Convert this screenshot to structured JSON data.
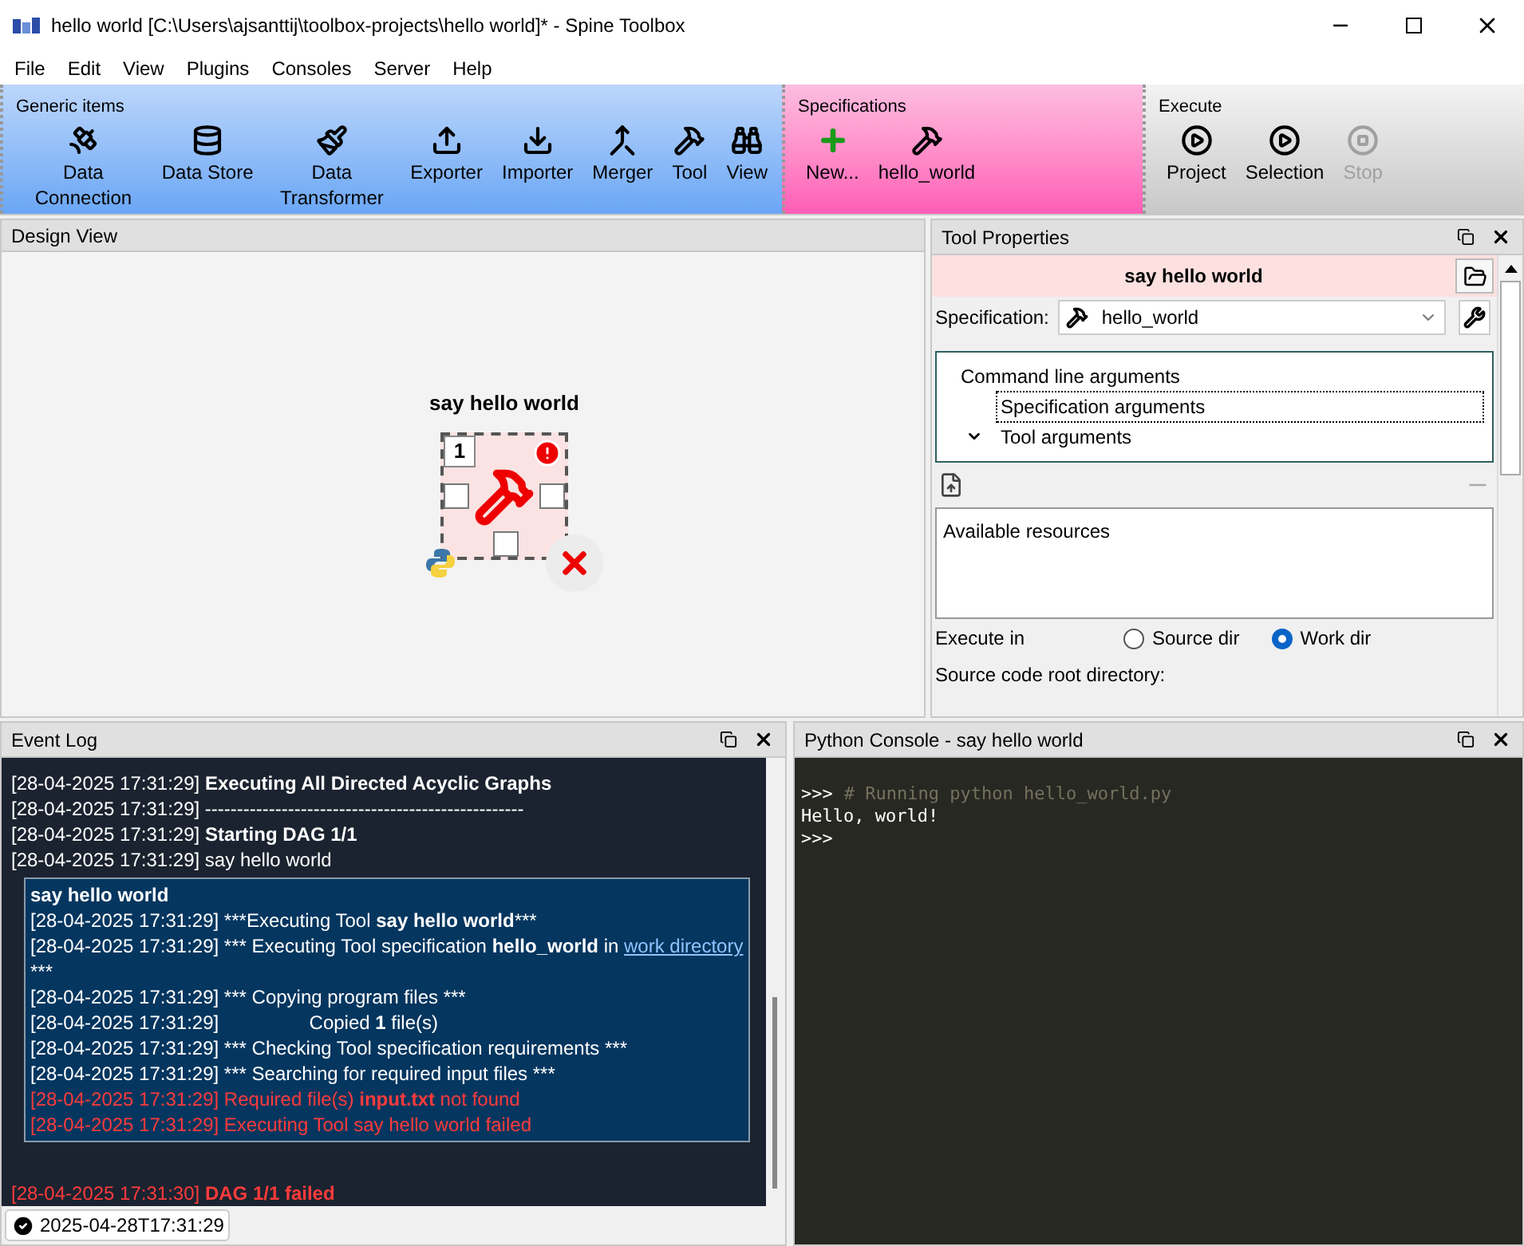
{
  "window": {
    "title": "hello world [C:\\Users\\ajsanttij\\toolbox-projects\\hello world]* - Spine Toolbox"
  },
  "menu": [
    "File",
    "Edit",
    "View",
    "Plugins",
    "Consoles",
    "Server",
    "Help"
  ],
  "toolbar": {
    "groups": [
      {
        "kind": "generic",
        "title": "Generic items",
        "items": [
          {
            "label": "Data Connection",
            "disabled": false
          },
          {
            "label": "Data Store",
            "disabled": false
          },
          {
            "label": "Data Transformer",
            "disabled": false
          },
          {
            "label": "Exporter",
            "disabled": false
          },
          {
            "label": "Importer",
            "disabled": false
          },
          {
            "label": "Merger",
            "disabled": false
          },
          {
            "label": "Tool",
            "disabled": false
          },
          {
            "label": "View",
            "disabled": false
          }
        ]
      },
      {
        "kind": "specs",
        "title": "Specifications",
        "items": [
          {
            "label": "New...",
            "disabled": false
          },
          {
            "label": "hello_world",
            "disabled": false
          }
        ]
      },
      {
        "kind": "execute",
        "title": "Execute",
        "items": [
          {
            "label": "Project",
            "disabled": false
          },
          {
            "label": "Selection",
            "disabled": false
          },
          {
            "label": "Stop",
            "disabled": true
          }
        ]
      }
    ]
  },
  "design_view": {
    "title": "Design View",
    "node": {
      "name": "say hello world",
      "badge": "1"
    }
  },
  "tool_properties": {
    "title": "Tool Properties",
    "item_name": "say hello world",
    "specification_label": "Specification:",
    "specification": "hello_world",
    "tree": [
      {
        "label": "Command line arguments",
        "children": [
          {
            "label": "Specification arguments",
            "selected": true
          },
          {
            "label": "Tool arguments",
            "selected": false,
            "expanded": true
          }
        ]
      }
    ],
    "available_resources": "Available resources",
    "execute_in_label": "Execute in",
    "execute_in": [
      {
        "label": "Source dir",
        "selected": false
      },
      {
        "label": "Work dir",
        "selected": true
      }
    ],
    "source_root_label": "Source code root directory:"
  },
  "event_log": {
    "title": "Event Log",
    "lines": [
      {
        "kind": "normal",
        "parts": [
          {
            "kind": "text",
            "text": "[28-04-2025 17:31:29] "
          },
          {
            "kind": "bold",
            "text": "Executing All Directed Acyclic Graphs"
          }
        ]
      },
      {
        "kind": "normal",
        "parts": [
          {
            "kind": "text",
            "text": "[28-04-2025 17:31:29] --------------------------------------------------"
          }
        ]
      },
      {
        "kind": "normal",
        "parts": [
          {
            "kind": "text",
            "text": "[28-04-2025 17:31:29] "
          },
          {
            "kind": "bold",
            "text": "Starting DAG 1/1"
          }
        ]
      },
      {
        "kind": "normal",
        "parts": [
          {
            "kind": "text",
            "text": "[28-04-2025 17:31:29] say hello world"
          }
        ]
      }
    ],
    "box": {
      "title": "say hello world",
      "lines": [
        {
          "kind": "normal",
          "parts": [
            {
              "kind": "text",
              "text": "[28-04-2025 17:31:29] ***Executing Tool "
            },
            {
              "kind": "bold",
              "text": "say hello world"
            },
            {
              "kind": "text",
              "text": "***"
            }
          ]
        },
        {
          "kind": "normal",
          "parts": [
            {
              "kind": "text",
              "text": "[28-04-2025 17:31:29] *** Executing Tool specification "
            },
            {
              "kind": "bold",
              "text": "hello_world"
            },
            {
              "kind": "text",
              "text": " in "
            },
            {
              "kind": "link",
              "text": "work directory"
            }
          ]
        },
        {
          "kind": "normal",
          "parts": [
            {
              "kind": "text",
              "text": "***"
            }
          ]
        },
        {
          "kind": "normal",
          "parts": [
            {
              "kind": "text",
              "text": "[28-04-2025 17:31:29] *** Copying program files ***"
            }
          ]
        },
        {
          "kind": "normal",
          "parts": [
            {
              "kind": "text",
              "text": "[28-04-2025 17:31:29]                 Copied "
            },
            {
              "kind": "bold",
              "text": "1"
            },
            {
              "kind": "text",
              "text": " file(s)"
            }
          ]
        },
        {
          "kind": "normal",
          "parts": [
            {
              "kind": "text",
              "text": "[28-04-2025 17:31:29] *** Checking Tool specification requirements ***"
            }
          ]
        },
        {
          "kind": "normal",
          "parts": [
            {
              "kind": "text",
              "text": "[28-04-2025 17:31:29] *** Searching for required input files ***"
            }
          ]
        },
        {
          "kind": "error",
          "parts": [
            {
              "kind": "text",
              "text": "[28-04-2025 17:31:29] Required file(s) "
            },
            {
              "kind": "bold",
              "text": "input.txt"
            },
            {
              "kind": "text",
              "text": " not found"
            }
          ]
        },
        {
          "kind": "error",
          "parts": [
            {
              "kind": "text",
              "text": "[28-04-2025 17:31:29] Executing Tool say hello world failed"
            }
          ]
        }
      ]
    },
    "after": [
      {
        "kind": "error",
        "parts": [
          {
            "kind": "text",
            "text": "[28-04-2025 17:31:30] "
          },
          {
            "kind": "bold",
            "text": "DAG 1/1 failed"
          }
        ]
      }
    ],
    "status": "2025-04-28T17:31:29"
  },
  "console": {
    "title": "Python Console - say hello world",
    "lines": [
      {
        "kind": "comment",
        "prompt": ">>>",
        "text": "# Running python hello_world.py"
      },
      {
        "kind": "output",
        "text": "Hello, world!"
      },
      {
        "kind": "prompt",
        "prompt": ">>>"
      }
    ]
  }
}
